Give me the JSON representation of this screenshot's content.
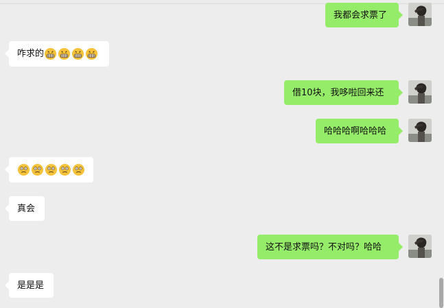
{
  "messages": [
    {
      "side": "mine",
      "text": "我都会求票了"
    },
    {
      "side": "theirs",
      "text": "咋求的",
      "emoji_name": "grinning-teeth-emoji",
      "emoji_count": 4
    },
    {
      "side": "mine",
      "text": "借10块，我哆啦回来还"
    },
    {
      "side": "mine",
      "text": "哈哈哈啊哈哈哈"
    },
    {
      "side": "theirs",
      "text": "",
      "emoji_name": "dizzy-face-emoji",
      "emoji_count": 5
    },
    {
      "side": "theirs",
      "text": "真会"
    },
    {
      "side": "mine",
      "text": "这不是求票吗？不对吗？哈哈"
    },
    {
      "side": "theirs",
      "text": "是是是"
    }
  ],
  "colors": {
    "mine_bubble": "#95ec69",
    "theirs_bubble": "#ffffff",
    "background": "#ededed"
  },
  "avatar": {
    "icon": "user-avatar-portrait"
  }
}
